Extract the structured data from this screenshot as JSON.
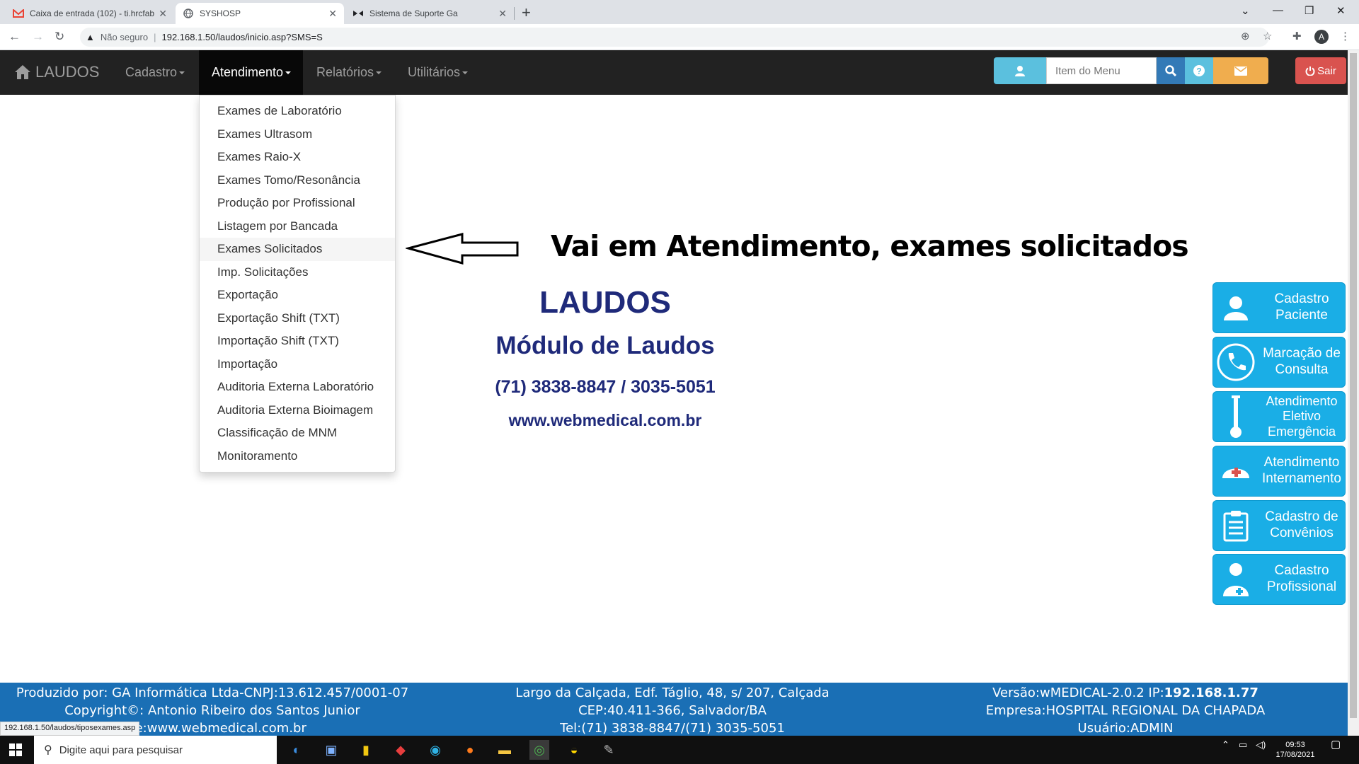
{
  "browser": {
    "tabs": [
      {
        "title": "Caixa de entrada (102) - ti.hrcfab",
        "icon": "gmail-icon"
      },
      {
        "title": "SYSHOSP",
        "icon": "globe-icon"
      },
      {
        "title": "Sistema de Suporte Ga",
        "icon": "app-icon"
      }
    ],
    "address": {
      "security": "Não seguro",
      "url": "192.168.1.50/laudos/inicio.asp?SMS=S"
    },
    "profile_initial": "A"
  },
  "navbar": {
    "brand": "LAUDOS",
    "menus": [
      "Cadastro",
      "Atendimento",
      "Relatórios",
      "Utilitários"
    ],
    "search_placeholder": "Item do Menu",
    "logout": "Sair"
  },
  "dropdown": {
    "items": [
      "Exames de Laboratório",
      "Exames Ultrasom",
      "Exames Raio-X",
      "Exames Tomo/Resonância",
      "Produção por Profissional",
      "Listagem por Bancada",
      "Exames Solicitados",
      "Imp. Solicitações",
      "Exportação",
      "Exportação Shift (TXT)",
      "Importação Shift (TXT)",
      "Importação",
      "Auditoria Externa Laboratório",
      "Auditoria Externa Bioimagem",
      "Classificação de MNM",
      "Monitoramento"
    ],
    "highlighted_index": 6
  },
  "annotation": "Vai em Atendimento, exames solicitados",
  "logo": {
    "title": "LAUDOS",
    "subtitle": "Módulo de Laudos",
    "phone": "(71) 3838-8847 / 3035-5051",
    "site": "www.webmedical.com.br"
  },
  "shortcuts": [
    {
      "label": "Cadastro Paciente",
      "icon": "user-icon"
    },
    {
      "label": "Marcação de Consulta",
      "icon": "phone-icon"
    },
    {
      "label": "Atendimento Eletivo Emergência",
      "icon": "thermometer-icon"
    },
    {
      "label": "Atendimento Internamento",
      "icon": "nurse-cap-icon"
    },
    {
      "label": "Cadastro de Convênios",
      "icon": "clipboard-icon"
    },
    {
      "label": "Cadastro Profissional",
      "icon": "doctor-icon"
    }
  ],
  "footer": {
    "left": [
      "Produzido por: GA Informática Ltda-CNPJ:13.612.457/0001-07",
      "Copyright©: Antonio Ribeiro dos Santos Junior",
      "Site:www.webmedical.com.br"
    ],
    "center": [
      "Largo da Calçada, Edf. Táglio, 48, s/ 207, Calçada",
      "CEP:40.411-366, Salvador/BA",
      "Tel:(71) 3838-8847/(71) 3035-5051"
    ],
    "right_version": "Versão:wMEDICAL-2.0.2 IP:",
    "right_ip": "192.168.1.77",
    "right": [
      "Empresa:HOSPITAL REGIONAL DA CHAPADA",
      "Usuário:ADMIN"
    ]
  },
  "status_url": "192.168.1.50/laudos/tiposexames.asp",
  "taskbar": {
    "search_placeholder": "Digite aqui para pesquisar",
    "time": "09:53",
    "date": "17/08/2021"
  },
  "colors": {
    "navbar": "#222222",
    "footer": "#1a6fb5",
    "shortcut": "#1aaee6",
    "logo_text": "#1f2a7a",
    "logout": "#d9534f",
    "info": "#5bc0de",
    "warning": "#f0ad4e",
    "primary": "#337ab7"
  }
}
